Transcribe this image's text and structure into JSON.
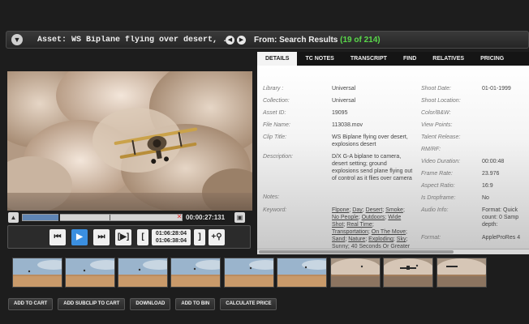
{
  "header": {
    "asset_label": "Asset: WS Biplane flying over desert, ...",
    "from_label": "From: Search Results",
    "from_count": "(19 of 214)"
  },
  "player": {
    "current_time": "00:00:27:131",
    "played_fraction": 0.23,
    "timecode_in": "01:06:28:04",
    "timecode_out": "01:06:38:04",
    "mark_in_glyph": "[",
    "mark_out_glyph": "]"
  },
  "tabs": [
    "DETAILS",
    "TC NOTES",
    "TRANSCRIPT",
    "FIND",
    "RELATIVES",
    "PRICING"
  ],
  "details": {
    "left": [
      {
        "label": "Library :",
        "value": "Universal"
      },
      {
        "label": "Collection:",
        "value": "Universal"
      },
      {
        "label": "Asset ID:",
        "value": "19095"
      },
      {
        "label": "File Name:",
        "value": "113038.mov"
      },
      {
        "label": "Clip Title:",
        "value": "WS Biplane flying over desert, explosions desert"
      },
      {
        "label": "Description:",
        "value": "D/X G-A biplane to camera, desert setting; ground explosions send plane flying out of control as it flies over camera"
      },
      {
        "label": "Notes:",
        "value": ""
      },
      {
        "label": "Keyword:",
        "value": ""
      }
    ],
    "keywords_line1": [
      "Flpone",
      "Day",
      "Desert",
      "Smoke"
    ],
    "keywords_line2": [
      "No People",
      "Outdoors",
      "Wide"
    ],
    "keywords_line3": [
      "Shot",
      "Real Time"
    ],
    "keywords_line4": [
      "Transportation",
      "On The Move"
    ],
    "keywords_line5": [
      "Sand",
      "Nature",
      "Exploding",
      "Sky"
    ],
    "keywords_line6": "Sunny; 40 Seconds Or Greater",
    "right": [
      {
        "label": "Shoot Date:",
        "value": "01-01-1999"
      },
      {
        "label": "Shoot Location:",
        "value": ""
      },
      {
        "label": "Color/B&W:",
        "value": ""
      },
      {
        "label": "View Points:",
        "value": ""
      },
      {
        "label": "Talent Release:",
        "value": ""
      },
      {
        "label": "RM/RF:",
        "value": ""
      },
      {
        "label": "Video Duration:",
        "value": "00:00:48"
      },
      {
        "label": "Frame Rate:",
        "value": "23.976"
      },
      {
        "label": "Aspect Ratio:",
        "value": "16:9"
      },
      {
        "label": "Is Dropframe:",
        "value": "No"
      },
      {
        "label": "Audio Info:",
        "value": "Format: Quick count: 0 Samp depth:"
      },
      {
        "label": "Format:",
        "value": "AppleProRes 4"
      }
    ]
  },
  "filmstrip_count": 9,
  "actions": [
    "ADD TO CART",
    "ADD SUBCLIP TO CART",
    "DOWNLOAD",
    "ADD TO BIN",
    "CALCULATE PRICE"
  ],
  "colors": {
    "accent_count": "#59d94a",
    "play_button": "#3b8fe0",
    "scrub_played": "#5f85b4"
  }
}
